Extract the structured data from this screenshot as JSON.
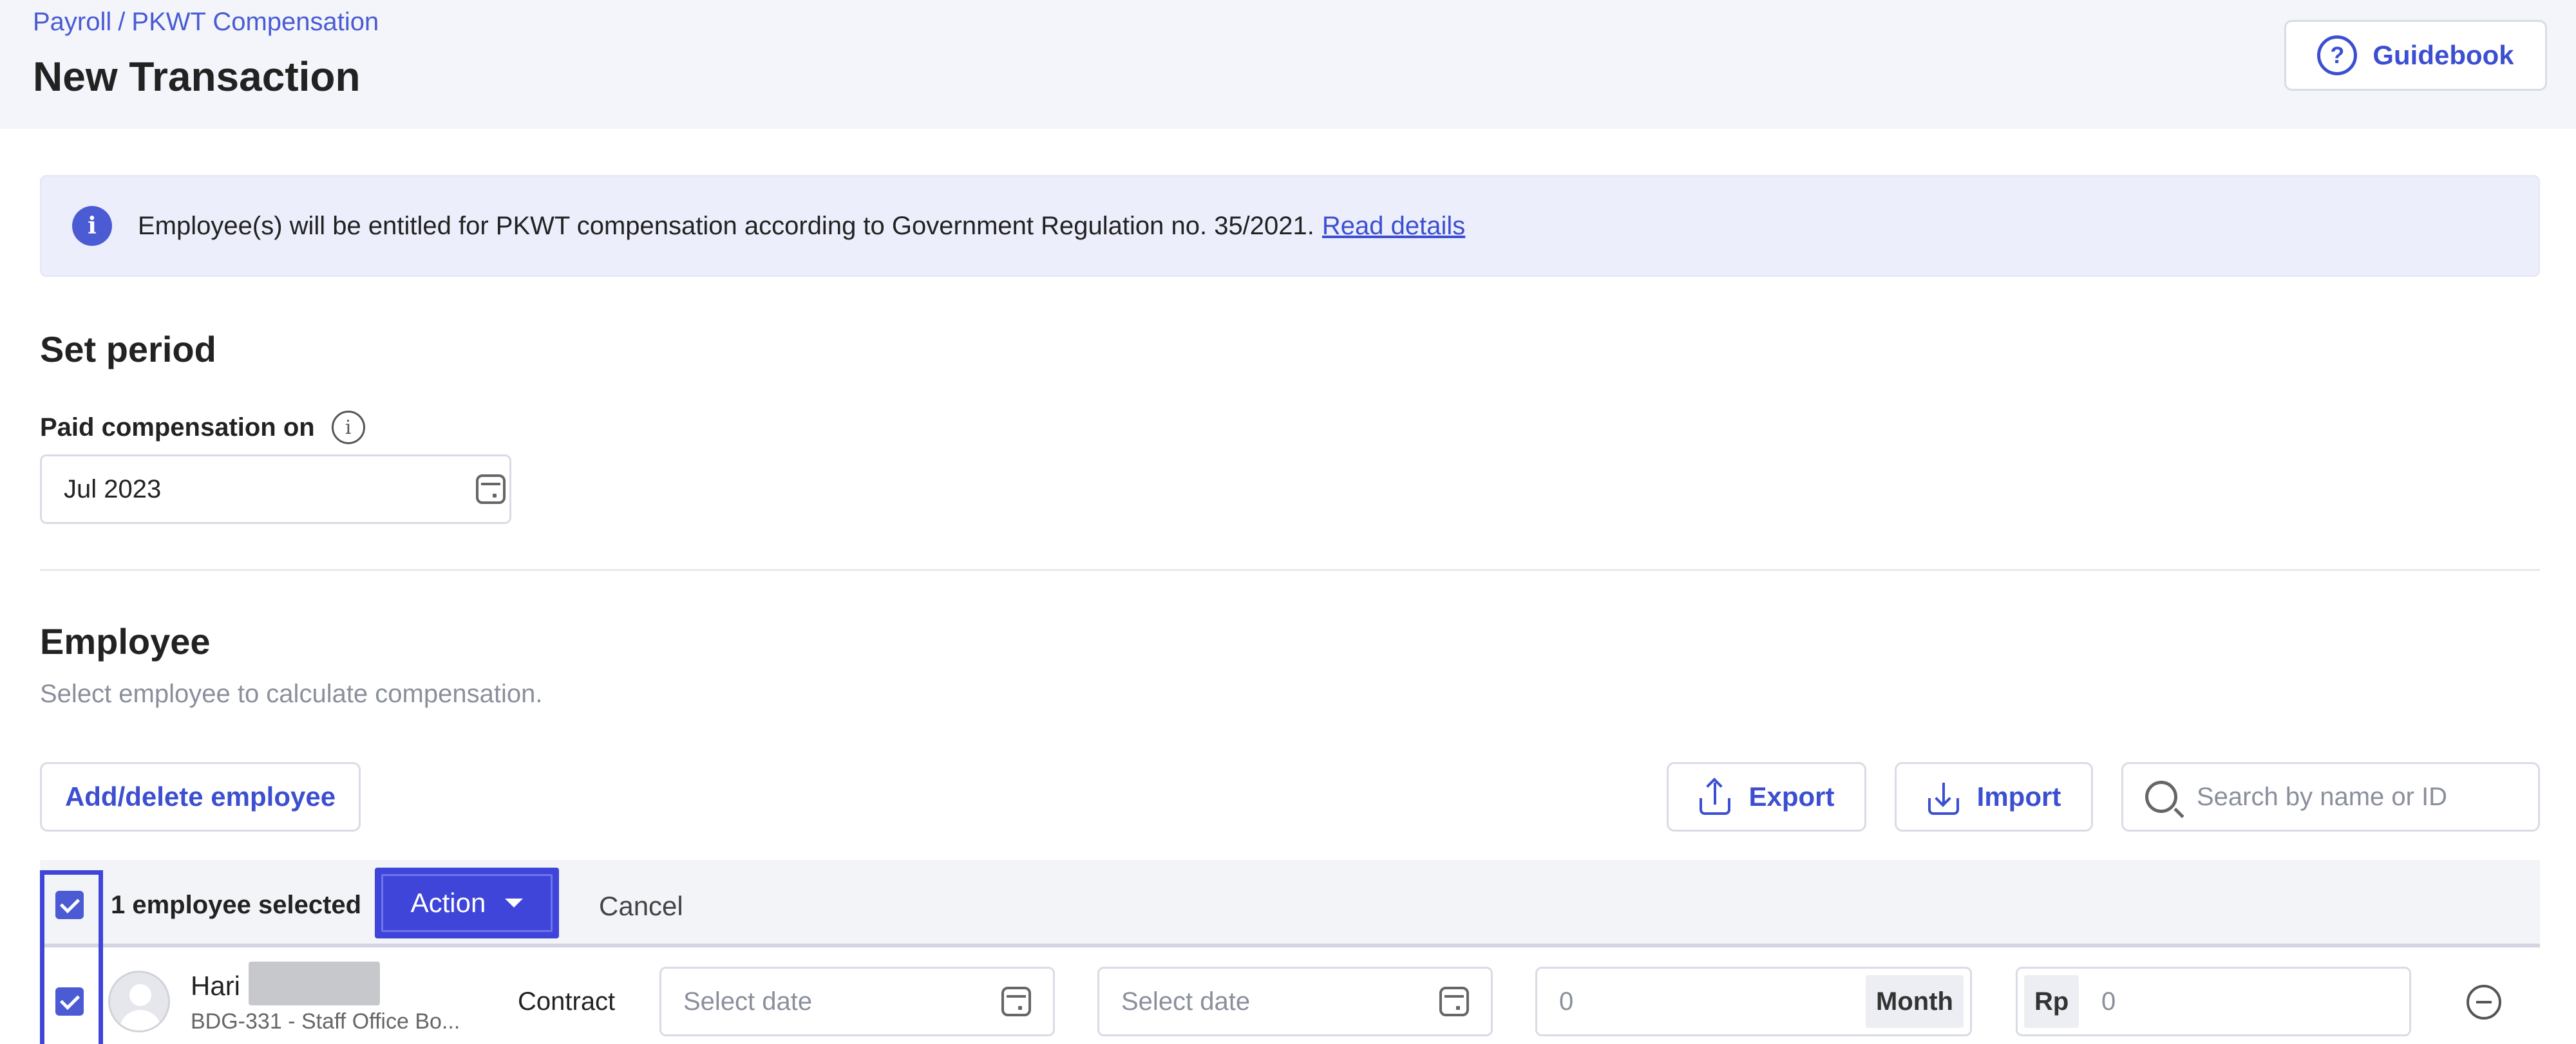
{
  "header": {
    "breadcrumb": [
      "Payroll",
      "PKWT Compensation"
    ],
    "breadcrumb_separator": "/",
    "title": "New Transaction",
    "guidebook_label": "Guidebook"
  },
  "banner": {
    "text": "Employee(s) will be entitled for PKWT compensation according to Government Regulation no. 35/2021.",
    "link_label": "Read details"
  },
  "period": {
    "title": "Set period",
    "paid_label": "Paid compensation on",
    "paid_value": "Jul 2023"
  },
  "employee_section": {
    "title": "Employee",
    "subtitle": "Select employee to calculate compensation.",
    "add_delete_label": "Add/delete employee",
    "export_label": "Export",
    "import_label": "Import",
    "search_placeholder": "Search by name or ID"
  },
  "selection": {
    "count_label": "1 employee selected",
    "action_label": "Action",
    "cancel_label": "Cancel",
    "all_checked": true
  },
  "rows": [
    {
      "checked": true,
      "name": "Hari",
      "sub": "BDG-331 - Staff Office Bo...",
      "type": "Contract",
      "start_placeholder": "Select date",
      "end_placeholder": "Select date",
      "duration_value": "0",
      "duration_unit": "Month",
      "currency": "Rp",
      "amount_value": "0"
    }
  ],
  "colors": {
    "accent": "#3c4fd0",
    "highlight": "#3e45d8",
    "header_bg": "#f3f5fa",
    "banner_bg": "#eceefb"
  }
}
